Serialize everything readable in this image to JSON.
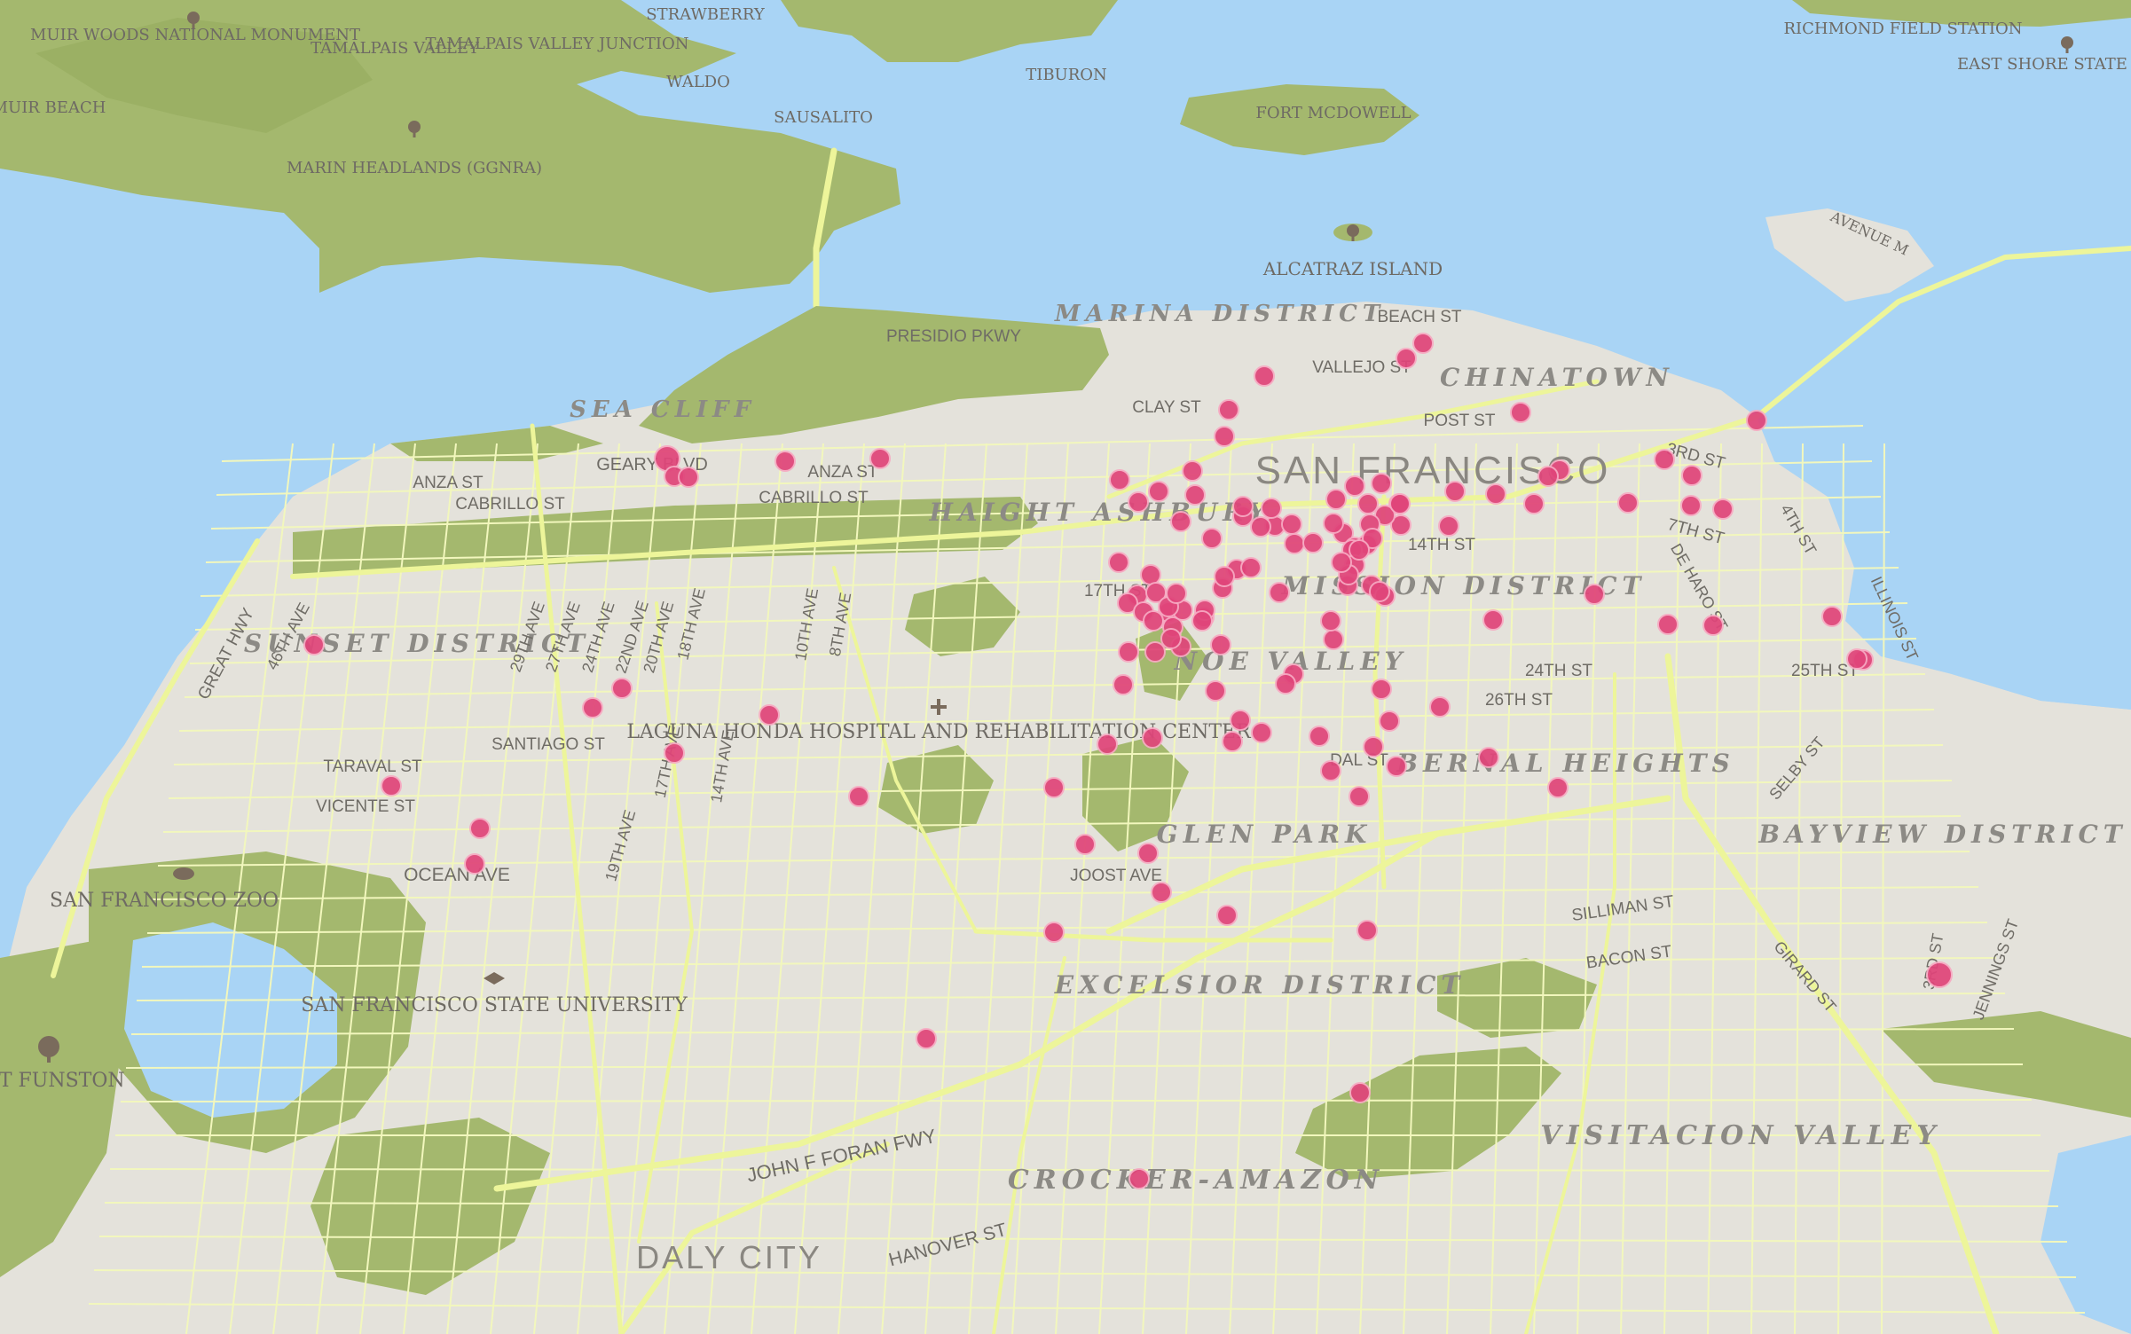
{
  "colors": {
    "water": "#a9d4f5",
    "land": "#e4e2db",
    "park": "#a4b86e",
    "road": "#edf59a",
    "marker": "#e0457a",
    "label": "#6e6a64",
    "district_label": "#8c8a85"
  },
  "marker_radius_px": 11,
  "labels": {
    "muir_woods": "MUIR WOODS NATIONAL MONUMENT",
    "tamalpais": "TAMALPAIS VALLEY",
    "tamalpais_junction": "TAMALPAIS VALLEY JUNCTION",
    "strawberry": "STRAWBERRY",
    "waldo": "WALDO",
    "tiburon": "TIBURON",
    "sausalito": "SAUSALITO",
    "muir_beach": "MUIR BEACH",
    "marin_headlands": "MARIN HEADLANDS (GGNRA)",
    "fort_mcdowell": "FORT MCDOWELL",
    "richmond_field": "RICHMOND FIELD STATION",
    "east_shore": "EAST SHORE STATE PARK",
    "alcatraz": "ALCATRAZ ISLAND",
    "avenue_m": "AVENUE M",
    "presidio_pkwy": "PRESIDIO PKWY",
    "beach_st": "BEACH ST",
    "marina": "MARINA DISTRICT",
    "vallejo_st": "VALLEJO ST",
    "chinatown": "CHINATOWN",
    "clay_st": "CLAY ST",
    "post_st": "POST ST",
    "sea_cliff": "SEA CLIFF",
    "geary_blvd": "GEARY BLVD",
    "anza_st": "ANZA ST",
    "cabrillo_st": "CABRILLO ST",
    "san_francisco": "SAN FRANCISCO",
    "third_st": "3RD ST",
    "seventh_st": "7TH ST",
    "fourth_st": "4TH ST",
    "haight": "HAIGHT ASHBURY",
    "fourteenth_st": "14TH ST",
    "de_haro_st": "DE HARO ST",
    "illinois_st": "ILLINOIS ST",
    "seventeenth_st": "17TH ST",
    "mission": "MISSION DISTRICT",
    "great_hwy": "GREAT HWY",
    "ave46": "46TH AVE",
    "sunset": "SUNSET DISTRICT",
    "ave29": "29TH AVE",
    "ave27": "27TH AVE",
    "ave24": "24TH AVE",
    "ave22": "22ND AVE",
    "ave20": "20TH AVE",
    "ave18": "18TH AVE",
    "ave10": "10TH AVE",
    "ave8": "8TH AVE",
    "noe": "NOE VALLEY",
    "st24": "24TH ST",
    "st25": "25TH ST",
    "st26": "26TH ST",
    "ave17": "17TH AVE",
    "ave14": "14TH AVE",
    "laguna_honda": "LAGUNA HONDA HOSPITAL AND REHABILITATION CENTER",
    "santiago_st": "SANTIAGO ST",
    "taraval_st": "TARAVAL ST",
    "vicente_st": "VICENTE ST",
    "ave19": "19TH AVE",
    "dal_st": "DAL ST",
    "bernal": "BERNAL HEIGHTS",
    "selby_st": "SELBY ST",
    "bayview": "BAYVIEW DISTRICT",
    "sf_zoo": "SAN FRANCISCO ZOO",
    "ocean_ave": "OCEAN AVE",
    "glen_park": "GLEN PARK",
    "joost_ave": "JOOST AVE",
    "silliman_st": "SILLIMAN ST",
    "bacon_st": "BACON ST",
    "girard_st": "GIRARD ST",
    "third_st_south": "3RD ST",
    "jennings_st": "JENNINGS ST",
    "sfsu": "SAN FRANCISCO STATE UNIVERSITY",
    "excelsior": "EXCELSIOR DISTRICT",
    "fort_funston": "FORT FUNSTON",
    "visitacion": "VISITACION VALLEY",
    "john_f_foran": "JOHN F FORAN FWY",
    "crocker": "CROCKER-AMAZON",
    "hanover_st": "HANOVER ST",
    "daly_city": "DALY CITY"
  },
  "markers": [
    {
      "id": "m1"
    },
    {
      "id": "m2"
    },
    {
      "id": "m3"
    },
    {
      "id": "m4"
    },
    {
      "id": "m5"
    },
    {
      "id": "m6"
    },
    {
      "id": "m7"
    },
    {
      "id": "m8"
    },
    {
      "id": "m9"
    },
    {
      "id": "m10"
    },
    {
      "id": "m11"
    },
    {
      "id": "m12"
    },
    {
      "id": "m13"
    },
    {
      "id": "m14"
    },
    {
      "id": "m15"
    },
    {
      "id": "m16"
    },
    {
      "id": "m17"
    },
    {
      "id": "m18"
    },
    {
      "id": "m19"
    },
    {
      "id": "m20"
    },
    {
      "id": "m21"
    },
    {
      "id": "m22"
    },
    {
      "id": "m23"
    },
    {
      "id": "m24"
    },
    {
      "id": "m25"
    },
    {
      "id": "m26"
    },
    {
      "id": "m27"
    },
    {
      "id": "m28"
    },
    {
      "id": "m29"
    },
    {
      "id": "m30"
    },
    {
      "id": "m31"
    },
    {
      "id": "m32"
    },
    {
      "id": "m33"
    },
    {
      "id": "m34"
    },
    {
      "id": "m35"
    },
    {
      "id": "m36"
    },
    {
      "id": "m37"
    },
    {
      "id": "m38"
    },
    {
      "id": "m39"
    },
    {
      "id": "m40"
    },
    {
      "id": "m41"
    },
    {
      "id": "m42"
    },
    {
      "id": "m43"
    },
    {
      "id": "m44"
    },
    {
      "id": "m45"
    },
    {
      "id": "m46"
    },
    {
      "id": "m47"
    },
    {
      "id": "m48"
    },
    {
      "id": "m49"
    },
    {
      "id": "m50"
    },
    {
      "id": "m51"
    },
    {
      "id": "m52"
    },
    {
      "id": "m53"
    },
    {
      "id": "m54"
    },
    {
      "id": "m55"
    },
    {
      "id": "m56"
    },
    {
      "id": "m57"
    },
    {
      "id": "m58"
    },
    {
      "id": "m59"
    },
    {
      "id": "m60"
    },
    {
      "id": "m61"
    },
    {
      "id": "m62"
    },
    {
      "id": "m63"
    },
    {
      "id": "m64"
    },
    {
      "id": "m65"
    },
    {
      "id": "m66"
    },
    {
      "id": "m67"
    },
    {
      "id": "m68"
    },
    {
      "id": "m69"
    },
    {
      "id": "m70"
    },
    {
      "id": "m71"
    },
    {
      "id": "m72"
    },
    {
      "id": "m73"
    },
    {
      "id": "m74"
    },
    {
      "id": "m75"
    },
    {
      "id": "m76"
    },
    {
      "id": "m77"
    },
    {
      "id": "m78"
    },
    {
      "id": "m79"
    },
    {
      "id": "m80"
    },
    {
      "id": "m81"
    },
    {
      "id": "m82"
    },
    {
      "id": "m83"
    },
    {
      "id": "m84"
    },
    {
      "id": "m85"
    },
    {
      "id": "m86"
    },
    {
      "id": "m87"
    },
    {
      "id": "m88"
    },
    {
      "id": "m89"
    },
    {
      "id": "m90"
    },
    {
      "id": "m91"
    },
    {
      "id": "m92"
    },
    {
      "id": "m93"
    },
    {
      "id": "m94"
    },
    {
      "id": "m95"
    },
    {
      "id": "m96"
    },
    {
      "id": "m97"
    },
    {
      "id": "m98"
    },
    {
      "id": "m99"
    },
    {
      "id": "m100"
    },
    {
      "id": "m101"
    },
    {
      "id": "m102"
    },
    {
      "id": "m103"
    },
    {
      "id": "m104"
    },
    {
      "id": "m105"
    },
    {
      "id": "m106"
    },
    {
      "id": "m107"
    },
    {
      "id": "m108"
    },
    {
      "id": "m109"
    },
    {
      "id": "m110"
    },
    {
      "id": "m111"
    },
    {
      "id": "m112"
    },
    {
      "id": "m113"
    },
    {
      "id": "m114"
    },
    {
      "id": "m115"
    },
    {
      "id": "m116"
    },
    {
      "id": "m117"
    },
    {
      "id": "m118"
    },
    {
      "id": "m119"
    },
    {
      "id": "m120"
    },
    {
      "id": "m121"
    },
    {
      "id": "m122"
    },
    {
      "id": "m123"
    },
    {
      "id": "m124"
    },
    {
      "id": "m125"
    },
    {
      "id": "m126"
    },
    {
      "id": "m127"
    },
    {
      "id": "m128"
    },
    {
      "id": "m129"
    },
    {
      "id": "m130"
    },
    {
      "id": "m131"
    },
    {
      "id": "m132"
    },
    {
      "id": "m133"
    },
    {
      "id": "m134"
    }
  ]
}
